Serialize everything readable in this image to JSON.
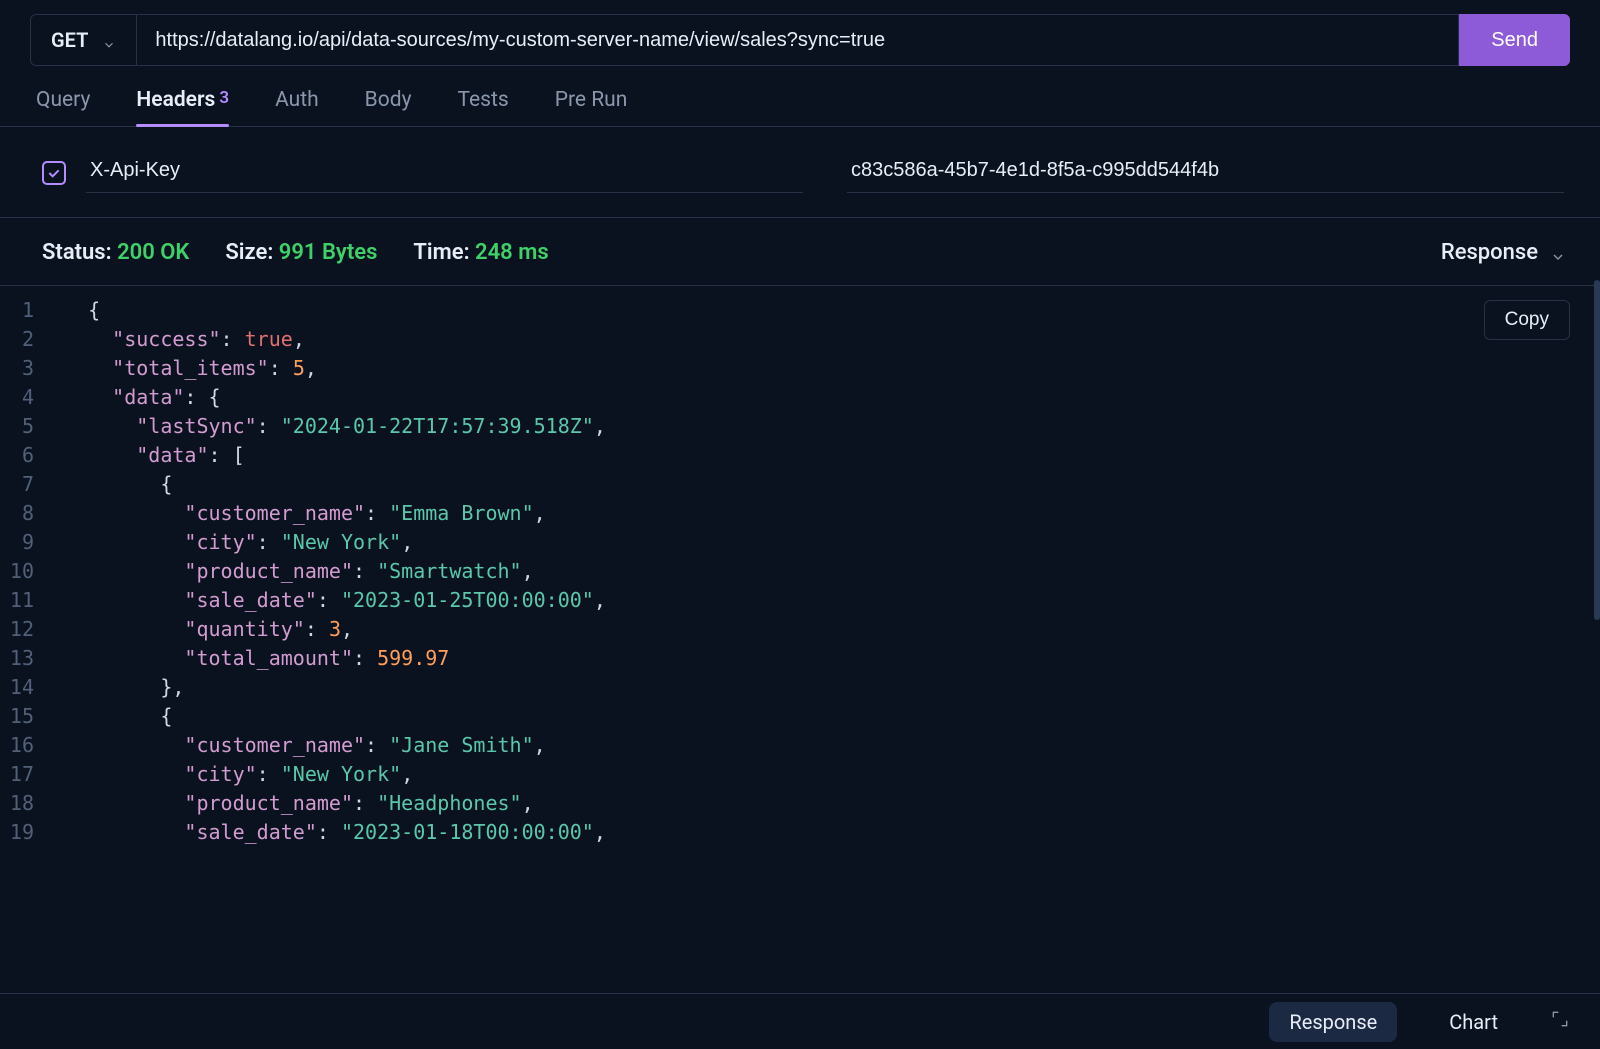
{
  "request": {
    "method": "GET",
    "url": "https://datalang.io/api/data-sources/my-custom-server-name/view/sales?sync=true",
    "send_label": "Send"
  },
  "tabs": [
    {
      "label": "Query"
    },
    {
      "label": "Headers",
      "badge": "3",
      "active": true
    },
    {
      "label": "Auth"
    },
    {
      "label": "Body"
    },
    {
      "label": "Tests"
    },
    {
      "label": "Pre Run"
    }
  ],
  "header_row": {
    "checked": true,
    "key": "X-Api-Key",
    "value": "c83c586a-45b7-4e1d-8f5a-c995dd544f4b"
  },
  "status": {
    "status_label": "Status:",
    "status_value": "200 OK",
    "size_label": "Size:",
    "size_value": "991 Bytes",
    "time_label": "Time:",
    "time_value": "248 ms",
    "response_dropdown": "Response"
  },
  "copy_label": "Copy",
  "response_body": {
    "success": true,
    "total_items": 5,
    "data": {
      "lastSync": "2024-01-22T17:57:39.518Z",
      "data": [
        {
          "customer_name": "Emma Brown",
          "city": "New York",
          "product_name": "Smartwatch",
          "sale_date": "2023-01-25T00:00:00",
          "quantity": 3,
          "total_amount": 599.97
        },
        {
          "customer_name": "Jane Smith",
          "city": "New York",
          "product_name": "Headphones",
          "sale_date": "2023-01-18T00:00:00"
        }
      ]
    }
  },
  "code_lines": [
    {
      "n": 1,
      "i": 0,
      "t": [
        [
          "p",
          "{"
        ]
      ]
    },
    {
      "n": 2,
      "i": 1,
      "t": [
        [
          "k",
          "\"success\""
        ],
        [
          "p",
          ": "
        ],
        [
          "b",
          "true"
        ],
        [
          "p",
          ","
        ]
      ]
    },
    {
      "n": 3,
      "i": 1,
      "t": [
        [
          "k",
          "\"total_items\""
        ],
        [
          "p",
          ": "
        ],
        [
          "n",
          "5"
        ],
        [
          "p",
          ","
        ]
      ]
    },
    {
      "n": 4,
      "i": 1,
      "t": [
        [
          "k",
          "\"data\""
        ],
        [
          "p",
          ": {"
        ]
      ]
    },
    {
      "n": 5,
      "i": 2,
      "t": [
        [
          "k",
          "\"lastSync\""
        ],
        [
          "p",
          ": "
        ],
        [
          "s",
          "\"2024-01-22T17:57:39.518Z\""
        ],
        [
          "p",
          ","
        ]
      ]
    },
    {
      "n": 6,
      "i": 2,
      "t": [
        [
          "k",
          "\"data\""
        ],
        [
          "p",
          ": ["
        ]
      ]
    },
    {
      "n": 7,
      "i": 3,
      "t": [
        [
          "p",
          "{"
        ]
      ]
    },
    {
      "n": 8,
      "i": 4,
      "t": [
        [
          "k",
          "\"customer_name\""
        ],
        [
          "p",
          ": "
        ],
        [
          "s",
          "\"Emma Brown\""
        ],
        [
          "p",
          ","
        ]
      ]
    },
    {
      "n": 9,
      "i": 4,
      "t": [
        [
          "k",
          "\"city\""
        ],
        [
          "p",
          ": "
        ],
        [
          "s",
          "\"New York\""
        ],
        [
          "p",
          ","
        ]
      ]
    },
    {
      "n": 10,
      "i": 4,
      "t": [
        [
          "k",
          "\"product_name\""
        ],
        [
          "p",
          ": "
        ],
        [
          "s",
          "\"Smartwatch\""
        ],
        [
          "p",
          ","
        ]
      ]
    },
    {
      "n": 11,
      "i": 4,
      "t": [
        [
          "k",
          "\"sale_date\""
        ],
        [
          "p",
          ": "
        ],
        [
          "s",
          "\"2023-01-25T00:00:00\""
        ],
        [
          "p",
          ","
        ]
      ]
    },
    {
      "n": 12,
      "i": 4,
      "t": [
        [
          "k",
          "\"quantity\""
        ],
        [
          "p",
          ": "
        ],
        [
          "n",
          "3"
        ],
        [
          "p",
          ","
        ]
      ]
    },
    {
      "n": 13,
      "i": 4,
      "t": [
        [
          "k",
          "\"total_amount\""
        ],
        [
          "p",
          ": "
        ],
        [
          "n",
          "599.97"
        ]
      ]
    },
    {
      "n": 14,
      "i": 3,
      "t": [
        [
          "p",
          "},"
        ]
      ]
    },
    {
      "n": 15,
      "i": 3,
      "t": [
        [
          "p",
          "{"
        ]
      ]
    },
    {
      "n": 16,
      "i": 4,
      "t": [
        [
          "k",
          "\"customer_name\""
        ],
        [
          "p",
          ": "
        ],
        [
          "s",
          "\"Jane Smith\""
        ],
        [
          "p",
          ","
        ]
      ]
    },
    {
      "n": 17,
      "i": 4,
      "t": [
        [
          "k",
          "\"city\""
        ],
        [
          "p",
          ": "
        ],
        [
          "s",
          "\"New York\""
        ],
        [
          "p",
          ","
        ]
      ]
    },
    {
      "n": 18,
      "i": 4,
      "t": [
        [
          "k",
          "\"product_name\""
        ],
        [
          "p",
          ": "
        ],
        [
          "s",
          "\"Headphones\""
        ],
        [
          "p",
          ","
        ]
      ]
    },
    {
      "n": 19,
      "i": 4,
      "t": [
        [
          "k",
          "\"sale_date\""
        ],
        [
          "p",
          ": "
        ],
        [
          "s",
          "\"2023-01-18T00:00:00\""
        ],
        [
          "p",
          ","
        ]
      ]
    }
  ],
  "footer": {
    "response_tab": "Response",
    "chart_tab": "Chart"
  }
}
